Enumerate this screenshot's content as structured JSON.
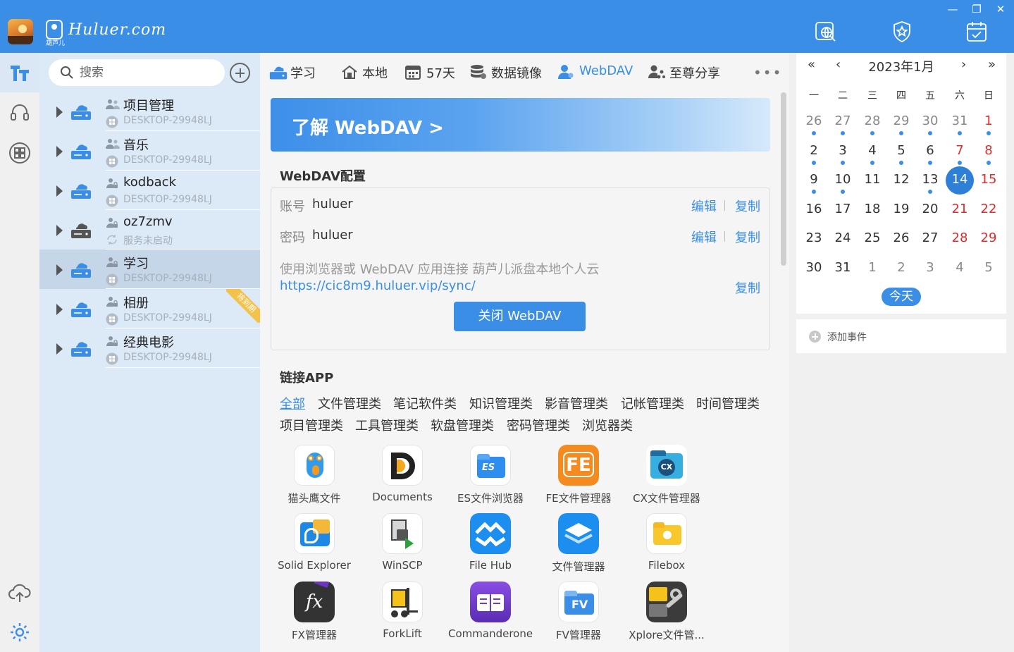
{
  "titlebar": {
    "brand_word": "Huluer.com",
    "brand_sub": "葫芦儿",
    "controls": {
      "minimize": "—",
      "maximize": "❐",
      "close": "✕"
    }
  },
  "sidebar": {
    "search_placeholder": "搜索",
    "disks": [
      {
        "name": "项目管理",
        "host": "DESKTOP-29948LJ",
        "shared": true
      },
      {
        "name": "音乐",
        "host": "DESKTOP-29948LJ",
        "shared": true
      },
      {
        "name": "kodback",
        "host": "DESKTOP-29948LJ",
        "shared": false
      },
      {
        "name": "oz7zmv",
        "host": "服务未启动",
        "shared": false,
        "offline": true
      },
      {
        "name": "学习",
        "host": "DESKTOP-29948LJ",
        "shared": false,
        "selected": true
      },
      {
        "name": "相册",
        "host": "DESKTOP-29948LJ",
        "shared": false,
        "ribbon": "将到期"
      },
      {
        "name": "经典电影",
        "host": "DESKTOP-29948LJ",
        "shared": false
      }
    ]
  },
  "topnav": {
    "items": [
      {
        "label": "学习",
        "icon": "drive-icon"
      },
      {
        "label": "本地",
        "icon": "home-icon"
      },
      {
        "label": "57天",
        "icon": "calendar-icon"
      },
      {
        "label": "数据镜像",
        "icon": "database-icon"
      },
      {
        "label": "WebDAV",
        "icon": "user-icon",
        "active": true
      },
      {
        "label": "至尊分享",
        "icon": "share-users-icon"
      }
    ],
    "more": "•••"
  },
  "banner": {
    "text": "了解  WebDAV >"
  },
  "webdav": {
    "title": "WebDAV配置",
    "account_key": "账号",
    "account_value": "huluer",
    "password_key": "密码",
    "password_value": "huluer",
    "edit_label": "编辑",
    "copy_label": "复制",
    "description": "使用浏览器或 WebDAV 应用连接 葫芦儿派盘本地个人云",
    "url": "https://cic8m9.huluer.vip/sync/",
    "close_button": "关闭 WebDAV"
  },
  "apps": {
    "title": "链接APP",
    "categories": [
      "全部",
      "文件管理类",
      "笔记软件类",
      "知识管理类",
      "影音管理类",
      "记帐管理类",
      "时间管理类",
      "项目管理类",
      "工具管理类",
      "软盘管理类",
      "密码管理类",
      "浏览器类"
    ],
    "active_category": "全部",
    "items": [
      {
        "label": "猫头鹰文件",
        "icon": "owl-icon"
      },
      {
        "label": "Documents",
        "icon": "documents-d-icon"
      },
      {
        "label": "ES文件浏览器",
        "icon": "es-folder-icon"
      },
      {
        "label": "FE文件管理器",
        "icon": "fe-icon"
      },
      {
        "label": "CX文件管理器",
        "icon": "cx-folder-icon"
      },
      {
        "label": "Solid Explorer",
        "icon": "solid-explorer-icon"
      },
      {
        "label": "WinSCP",
        "icon": "winscp-icon"
      },
      {
        "label": "File Hub",
        "icon": "filehub-icon"
      },
      {
        "label": "文件管理器",
        "icon": "layers-icon"
      },
      {
        "label": "Filebox",
        "icon": "filebox-icon"
      },
      {
        "label": "FX管理器",
        "icon": "fx-icon"
      },
      {
        "label": "ForkLift",
        "icon": "forklift-icon"
      },
      {
        "label": "Commanderone",
        "icon": "commander-icon"
      },
      {
        "label": "FV管理器",
        "icon": "fv-folder-icon"
      },
      {
        "label": "Xplore文件管...",
        "icon": "xplore-icon"
      }
    ]
  },
  "calendar": {
    "title": "2023年1月",
    "prev_year": "«",
    "prev_month": "‹",
    "next_month": "›",
    "next_year": "»",
    "weekdays": [
      "一",
      "二",
      "三",
      "四",
      "五",
      "六",
      "日"
    ],
    "days": [
      {
        "d": "26",
        "other": true,
        "dot": true
      },
      {
        "d": "27",
        "other": true,
        "dot": true
      },
      {
        "d": "28",
        "other": true,
        "dot": true
      },
      {
        "d": "29",
        "other": true,
        "dot": true
      },
      {
        "d": "30",
        "other": true,
        "dot": true
      },
      {
        "d": "31",
        "other": true,
        "dot": true
      },
      {
        "d": "1",
        "weekend": true,
        "dot": true
      },
      {
        "d": "2",
        "dot": true
      },
      {
        "d": "3",
        "dot": true
      },
      {
        "d": "4",
        "dot": true
      },
      {
        "d": "5",
        "dot": true
      },
      {
        "d": "6",
        "dot": true
      },
      {
        "d": "7",
        "weekend": true,
        "dot": true
      },
      {
        "d": "8",
        "weekend": true,
        "dot": true
      },
      {
        "d": "9",
        "dot": true
      },
      {
        "d": "10",
        "dot": true
      },
      {
        "d": "11"
      },
      {
        "d": "12"
      },
      {
        "d": "13",
        "dot": true
      },
      {
        "d": "14",
        "today": true
      },
      {
        "d": "15",
        "weekend": true
      },
      {
        "d": "16"
      },
      {
        "d": "17"
      },
      {
        "d": "18"
      },
      {
        "d": "19"
      },
      {
        "d": "20"
      },
      {
        "d": "21",
        "weekend": true
      },
      {
        "d": "22",
        "weekend": true
      },
      {
        "d": "23"
      },
      {
        "d": "24"
      },
      {
        "d": "25"
      },
      {
        "d": "26"
      },
      {
        "d": "27"
      },
      {
        "d": "28",
        "weekend": true
      },
      {
        "d": "29",
        "weekend": true
      },
      {
        "d": "30"
      },
      {
        "d": "31"
      },
      {
        "d": "1",
        "other": true
      },
      {
        "d": "2",
        "other": true
      },
      {
        "d": "3",
        "other": true
      },
      {
        "d": "4",
        "other": true
      },
      {
        "d": "5",
        "other": true
      }
    ],
    "today_button": "今天",
    "add_event": "添加事件"
  },
  "colors": {
    "accent": "#3a8ee6",
    "weekend": "#e02b2b",
    "ribbon": "#f4c24a"
  }
}
